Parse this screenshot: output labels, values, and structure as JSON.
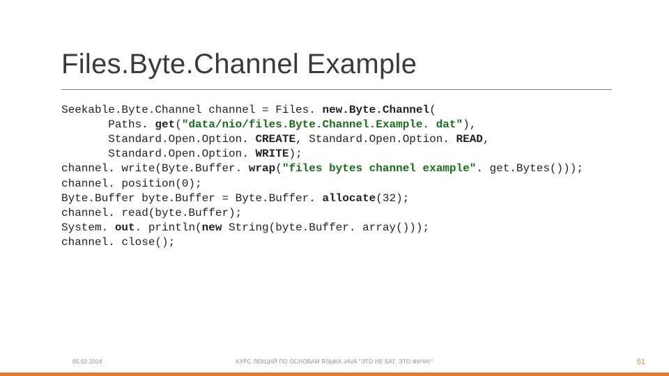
{
  "slide": {
    "title": "Files.Byte.Channel Example",
    "code": {
      "line1_a": "Seekable.Byte.Channel channel = Files. ",
      "line1_b": "new.Byte.Channel",
      "line1_c": "(",
      "line2_a": "       Paths. ",
      "line2_b": "get",
      "line2_c": "(",
      "line2_d": "\"data/nio/files.Byte.Channel.Example. dat\"",
      "line2_e": "),",
      "line3_a": "       Standard.Open.Option. ",
      "line3_b": "CREATE",
      "line3_c": ", Standard.Open.Option. ",
      "line3_d": "READ",
      "line3_e": ",",
      "line4_a": "       Standard.Open.Option. ",
      "line4_b": "WRITE",
      "line4_c": ");",
      "line5_a": "channel. write(Byte.Buffer. ",
      "line5_b": "wrap",
      "line5_c": "(",
      "line5_d": "\"files bytes channel example\"",
      "line5_e": ". get.Bytes()));",
      "line6": "channel. position(0);",
      "line7_a": "Byte.Buffer byte.Buffer = Byte.Buffer. ",
      "line7_b": "allocate",
      "line7_c": "(32);",
      "line8": "channel. read(byte.Buffer);",
      "line9_a": "System. ",
      "line9_b": "out",
      "line9_c": ". println(",
      "line9_d": "new ",
      "line9_e": "String(byte.Buffer. array()));",
      "line10": "channel. close();"
    },
    "footer": {
      "date": "05.02.2016",
      "center": "КУРС ЛЕКЦИЙ ПО ОСНОВАМ ЯЗЫКА JAVA \"ЭТО НЕ БАГ, ЭТО ФИЧА!\"",
      "page": "51"
    }
  }
}
